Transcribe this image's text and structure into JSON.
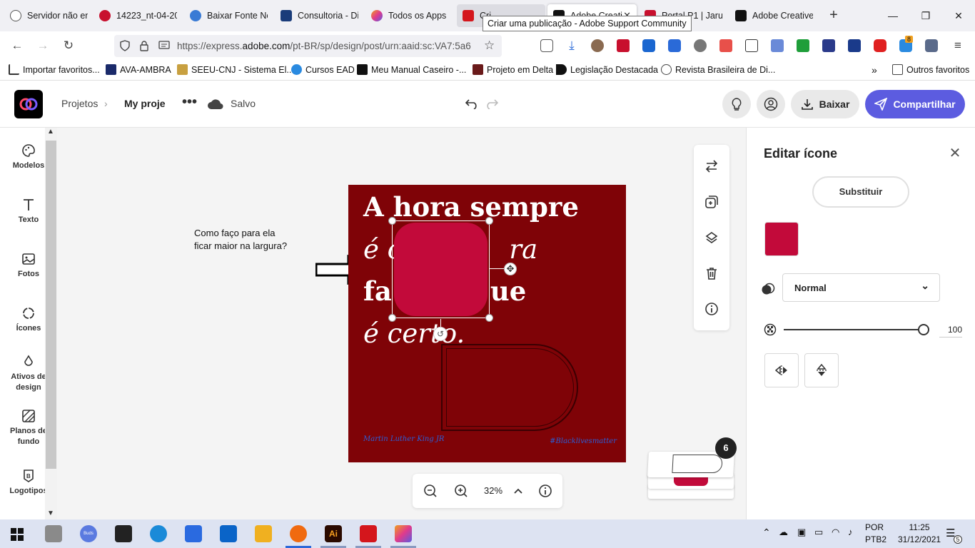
{
  "browser": {
    "tabs": [
      {
        "label": "Servidor não en",
        "color": "#555555"
      },
      {
        "label": "14223_nt-04-20",
        "color": "#c8102e"
      },
      {
        "label": "Baixar Fonte Ne",
        "color": "#3a7bd5"
      },
      {
        "label": "Consultoria - Di",
        "color": "#1a3c7a"
      },
      {
        "label": "Todos os Apps |",
        "color": "#e03a8c"
      },
      {
        "label": "Cri",
        "color": "#d4161c"
      },
      {
        "label": "Adobe Creati",
        "color": "#111111"
      },
      {
        "label": "Portal P1 | Jaru |",
        "color": "#c8102e"
      },
      {
        "label": "Adobe Creative",
        "color": "#111111"
      }
    ],
    "tooltip": "Criar uma publicação - Adobe Support Community",
    "url_prefix": "https://express.",
    "url_domain": "adobe.com",
    "url_rest": "/pt-BR/sp/design/post/urn:aaid:sc:VA7:5a6",
    "bookmarks": [
      "Importar favoritos...",
      "AVA-AMBRA",
      "SEEU-CNJ - Sistema El...",
      "Cursos EAD",
      "Meu Manual Caseiro -...",
      "Projeto em Delta",
      "Legislação Destacada",
      "Revista Brasileira de Di...",
      "Outros favoritos"
    ],
    "ext_badge": "8"
  },
  "app": {
    "breadcrumb_projects": "Projetos",
    "project_name": "My proje",
    "save_status": "Salvo",
    "download_label": "Baixar",
    "share_label": "Compartilhar",
    "accent": "#5c5ce0"
  },
  "rail": {
    "items": [
      "Modelos",
      "Texto",
      "Fotos",
      "Ícones",
      "Ativos de design",
      "Planos de fundo",
      "Logotipos"
    ]
  },
  "canvas": {
    "note_line1": "Como faço para ela",
    "note_line2": "ficar maior na largura?",
    "quote_line1": "A hora sempre",
    "quote_line2": "é c",
    "quote_line2b": "ra",
    "quote_line3": "fa",
    "quote_line3b": "ue",
    "quote_line4": "é certo.",
    "author": "Martin Luther King JR",
    "hashtag": "#Blacklivesmatter",
    "poster_color": "#7f0307",
    "icon_color": "#c20a3a",
    "zoom": "32%",
    "page_count": "6"
  },
  "panel": {
    "title": "Editar ícone",
    "replace_label": "Substituir",
    "blend_mode": "Normal",
    "opacity": "100",
    "swatch_color": "#c20a3a"
  },
  "taskbar": {
    "lang1": "POR",
    "lang2": "PTB2",
    "time": "11:25",
    "date": "31/12/2021",
    "notif_count": "5",
    "buds_label": "Buds"
  }
}
